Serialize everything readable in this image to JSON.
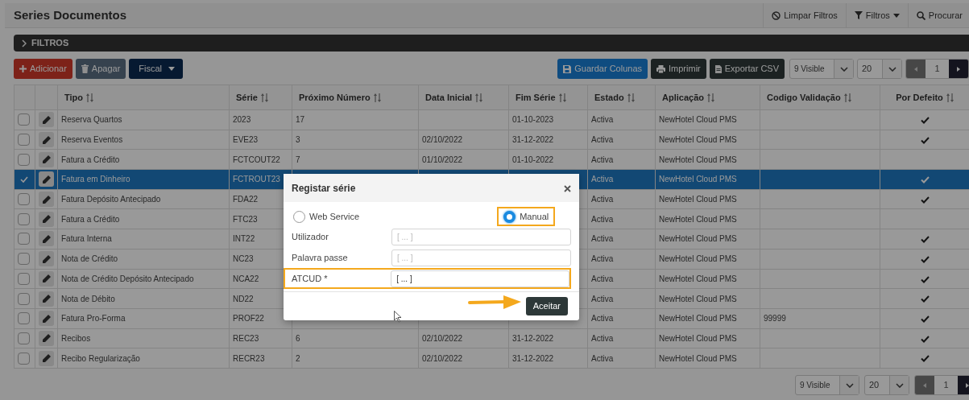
{
  "page": {
    "title": "Series Documentos"
  },
  "header_actions": [
    {
      "label": "Limpar Filtros",
      "kind": "clear"
    },
    {
      "label": "Filtros",
      "kind": "filter"
    },
    {
      "label": "Procurar",
      "kind": "search"
    }
  ],
  "filters_bar": {
    "label": "FILTROS",
    "expanded": false
  },
  "toolbar_left": [
    {
      "label": "Adicionar",
      "kind": "add"
    },
    {
      "label": "Apagar",
      "kind": "delete"
    },
    {
      "label": "Fiscal",
      "kind": "dropdown"
    }
  ],
  "toolbar_right": [
    {
      "label": "Guardar Colunas",
      "kind": "save"
    },
    {
      "label": "Imprimir",
      "kind": "print"
    },
    {
      "label": "Exportar CSV",
      "kind": "export"
    }
  ],
  "pagers": [
    {
      "visible": "9 Visible",
      "page_size": "20",
      "page": "1"
    },
    {
      "visible": "9 Visible",
      "page_size": "20",
      "page": "1"
    }
  ],
  "table": {
    "columns": [
      "Tipo",
      "Série",
      "Próximo Número",
      "Data Inicial",
      "Fim Série",
      "Estado",
      "Aplicação",
      "Codigo Validação",
      "Por Defeito"
    ],
    "rows": [
      {
        "selected": false,
        "default": true,
        "tipo": "Reserva Quartos",
        "serie": "2023",
        "proximo_numero": "17",
        "fim_serie": "01-10-2023",
        "estado": "Activa",
        "aplicacao": "NewHotel Cloud PMS"
      },
      {
        "selected": false,
        "default": true,
        "tipo": "Reserva Eventos",
        "serie": "EVE23",
        "proximo_numero": "3",
        "data_inicial": "02/10/2022",
        "fim_serie": "31-12-2022",
        "estado": "Activa",
        "aplicacao": "NewHotel Cloud PMS"
      },
      {
        "selected": false,
        "default": false,
        "tipo": "Fatura a Crédito",
        "serie": "FCTCOUT22",
        "proximo_numero": "7",
        "data_inicial": "01/10/2022",
        "fim_serie": "01-10-2022",
        "estado": "Activa",
        "aplicacao": "NewHotel Cloud PMS"
      },
      {
        "selected": true,
        "default": true,
        "tipo": "Fatura em Dinheiro",
        "serie": "FCTROUT23",
        "estado": "Activa",
        "aplicacao": "NewHotel Cloud PMS"
      },
      {
        "selected": false,
        "default": true,
        "tipo": "Fatura Depósito Antecipado",
        "serie": "FDA22",
        "estado": "Activa",
        "aplicacao": "NewHotel Cloud PMS"
      },
      {
        "selected": false,
        "default": false,
        "tipo": "Fatura a Crédito",
        "serie": "FTC23",
        "estado": "Activa",
        "aplicacao": "NewHotel Cloud PMS"
      },
      {
        "selected": false,
        "default": true,
        "tipo": "Fatura Interna",
        "serie": "INT22",
        "estado": "Activa",
        "aplicacao": "NewHotel Cloud PMS"
      },
      {
        "selected": false,
        "default": true,
        "tipo": "Nota de Crédito",
        "serie": "NC23",
        "estado": "Activa",
        "aplicacao": "NewHotel Cloud PMS"
      },
      {
        "selected": false,
        "default": true,
        "tipo": "Nota de Crédito Depósito Antecipado",
        "serie": "NCA22",
        "estado": "Activa",
        "aplicacao": "NewHotel Cloud PMS"
      },
      {
        "selected": false,
        "default": true,
        "tipo": "Nota de Débito",
        "serie": "ND22",
        "estado": "Activa",
        "aplicacao": "NewHotel Cloud PMS"
      },
      {
        "selected": false,
        "default": true,
        "tipo": "Fatura Pro-Forma",
        "serie": "PROF22",
        "estado": "Activa",
        "aplicacao": "NewHotel Cloud PMS",
        "codigo_validacao": "99999"
      },
      {
        "selected": false,
        "default": true,
        "tipo": "Recibos",
        "serie": "REC23",
        "proximo_numero": "6",
        "data_inicial": "02/10/2022",
        "fim_serie": "31-12-2022",
        "estado": "Activa",
        "aplicacao": "NewHotel Cloud PMS"
      },
      {
        "selected": false,
        "default": true,
        "tipo": "Recibo Regularização",
        "serie": "RECR23",
        "proximo_numero": "2",
        "data_inicial": "02/10/2022",
        "fim_serie": "31-12-2022",
        "estado": "Activa",
        "aplicacao": "NewHotel Cloud PMS"
      }
    ]
  },
  "dialog": {
    "title": "Registar série",
    "modes": [
      {
        "label": "Web Service",
        "selected": false,
        "highlighted": false
      },
      {
        "label": "Manual",
        "selected": true,
        "highlighted": true
      }
    ],
    "fields": [
      {
        "label": "Utilizador",
        "placeholder": "[ ... ]",
        "highlighted": false
      },
      {
        "label": "Palavra passe",
        "placeholder": "[ ... ]",
        "highlighted": false
      },
      {
        "label": "ATCUD *",
        "value": "[ ... ]",
        "highlighted": true
      }
    ],
    "accept_button": {
      "label": "Aceitar",
      "highlighted": true
    }
  }
}
